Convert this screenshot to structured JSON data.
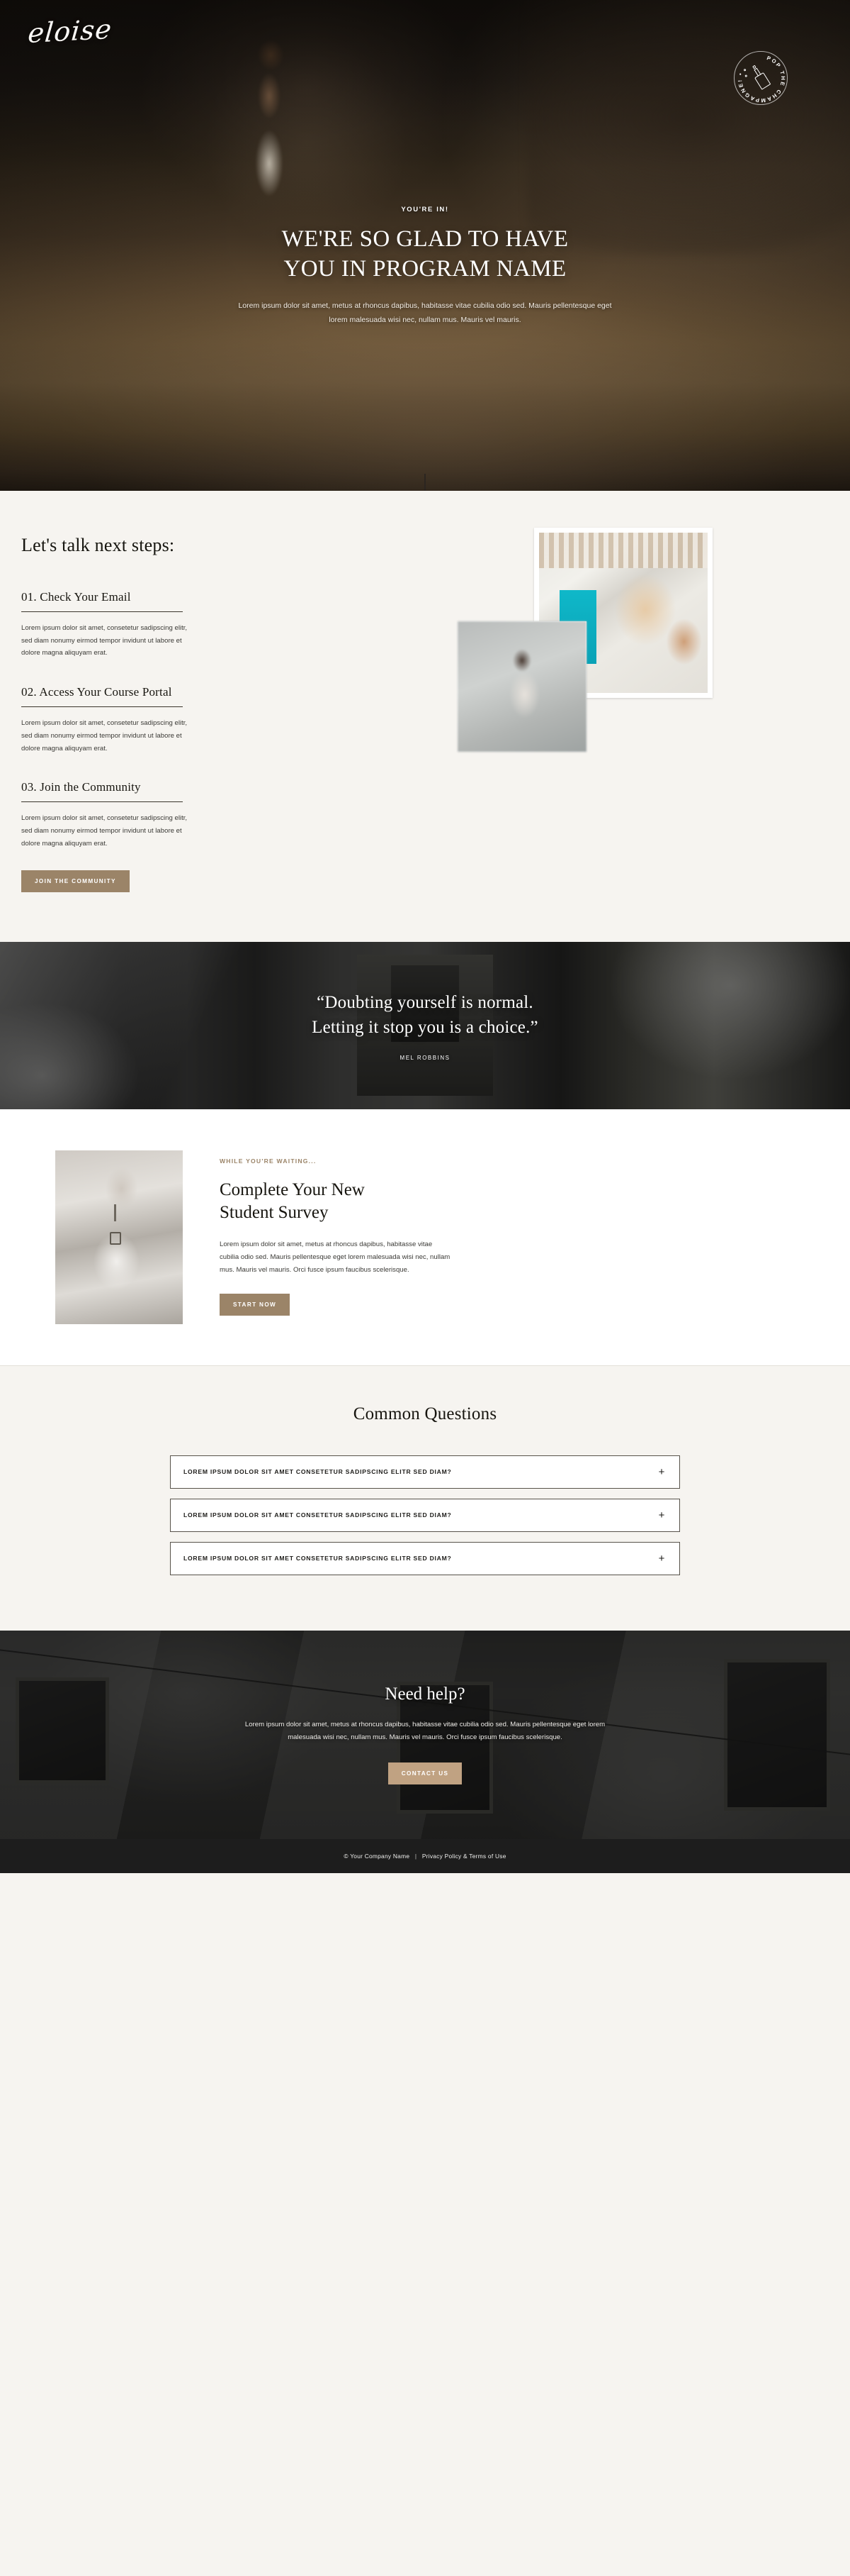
{
  "brand": {
    "logo_text": "eloise",
    "accent_color": "#9b8468",
    "accent_light": "#c0a282",
    "page_bg": "#f6f4f0"
  },
  "hero": {
    "eyebrow": "YOU'RE IN!",
    "title_line1": "WE'RE SO GLAD TO HAVE",
    "title_line2": "YOU IN PROGRAM NAME",
    "subtitle": "Lorem ipsum dolor sit amet, metus at rhoncus dapibus, habitasse vitae cubilia odio sed. Mauris pellentesque eget lorem malesuada wisi nec, nullam mus. Mauris vel mauris.",
    "badge_text": "POP THE CHAMPAGNE! • ",
    "badge_icon": "champagne-bottle-icon",
    "scroll_icon": "arrow-down-icon"
  },
  "steps": {
    "title": "Let's talk next steps:",
    "items": [
      {
        "heading": "01. Check Your Email",
        "body": "Lorem ipsum dolor sit amet, consetetur sadipscing elitr, sed diam nonumy eirmod tempor invidunt ut labore et dolore magna aliquyam erat."
      },
      {
        "heading": "02. Access Your Course Portal",
        "body": "Lorem ipsum dolor sit amet, consetetur sadipscing elitr, sed diam nonumy eirmod tempor invidunt ut labore et dolore magna aliquyam erat."
      },
      {
        "heading": "03. Join the Community",
        "body": "Lorem ipsum dolor sit amet, consetetur sadipscing elitr, sed diam nonumy eirmod tempor invidunt ut labore et dolore magna aliquyam erat."
      }
    ],
    "cta_label": "JOIN THE COMMUNITY"
  },
  "quote": {
    "line1": "“Doubting yourself is normal.",
    "line2": "Letting it stop you is a choice.”",
    "author": "MEL ROBBINS"
  },
  "survey": {
    "eyebrow": "WHILE YOU'RE WAITING...",
    "title_line1": "Complete Your New",
    "title_line2": "Student Survey",
    "body": "Lorem ipsum dolor sit amet, metus at rhoncus dapibus, habitasse vitae cubilia odio sed. Mauris pellentesque eget lorem malesuada wisi nec, nullam mus. Mauris vel mauris. Orci fusce ipsum faucibus scelerisque.",
    "cta_label": "START NOW"
  },
  "faq": {
    "title": "Common Questions",
    "items": [
      {
        "question": "LOREM IPSUM DOLOR SIT AMET CONSETETUR SADIPSCING ELITR SED DIAM?",
        "toggle": "+"
      },
      {
        "question": "LOREM IPSUM DOLOR SIT AMET CONSETETUR SADIPSCING ELITR SED DIAM?",
        "toggle": "+"
      },
      {
        "question": "LOREM IPSUM DOLOR SIT AMET CONSETETUR SADIPSCING ELITR SED DIAM?",
        "toggle": "+"
      }
    ]
  },
  "help": {
    "title": "Need help?",
    "body": "Lorem ipsum dolor sit amet, metus at rhoncus dapibus, habitasse vitae cubilia odio sed. Mauris pellentesque eget lorem malesuada wisi nec, nullam mus. Mauris vel mauris. Orci fusce ipsum faucibus scelerisque.",
    "cta_label": "CONTACT US"
  },
  "footer": {
    "copyright": "© Your Company Name",
    "separator": "|",
    "legal_link": "Privacy Policy & Terms of Use"
  }
}
